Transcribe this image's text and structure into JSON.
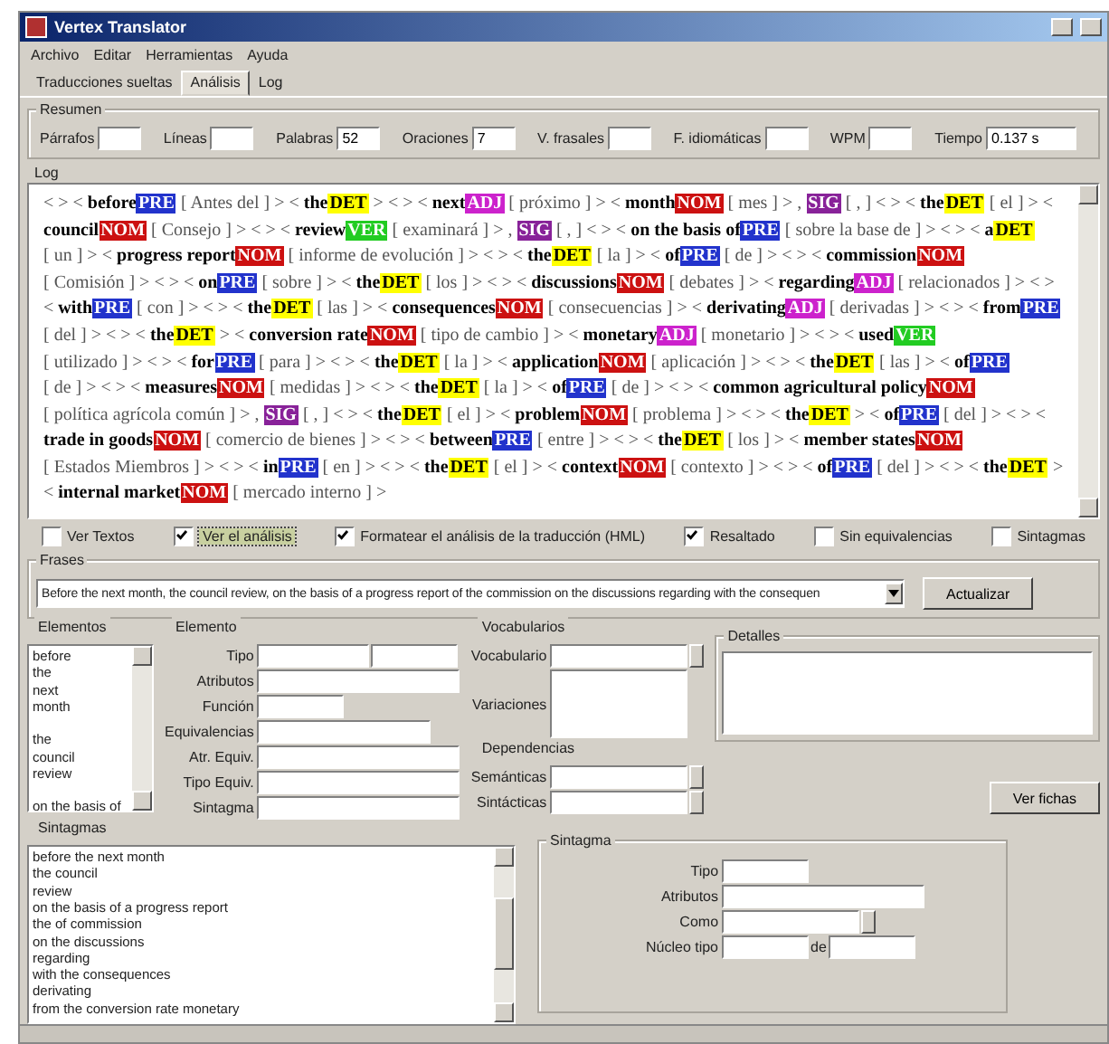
{
  "window": {
    "title": "Vertex Translator"
  },
  "menu": [
    "Archivo",
    "Editar",
    "Herramientas",
    "Ayuda"
  ],
  "tabs": [
    {
      "label": "Traducciones sueltas",
      "selected": false
    },
    {
      "label": "Análisis",
      "selected": true
    },
    {
      "label": "Log",
      "selected": false
    }
  ],
  "summary": {
    "title": "Resumen",
    "fields": [
      {
        "label": "Párrafos"
      },
      {
        "label": "Líneas"
      },
      {
        "label": "Palabras",
        "value": "52"
      },
      {
        "label": "Oraciones",
        "value": "7"
      },
      {
        "label": "V. frasales"
      },
      {
        "label": "F. idiomáticas"
      },
      {
        "label": "WPM"
      },
      {
        "label": "Tiempo",
        "value": "0.137 s"
      }
    ]
  },
  "log": {
    "title": "Log",
    "tokens": [
      {
        "pre": "< > <",
        "word": "before",
        "tag": "PRE",
        "color": "#2233cc",
        "post": "[ Antes del ] >"
      },
      {
        "pre": "<",
        "word": "the",
        "tag": "DET",
        "color": "#ffff00",
        "post": ">"
      },
      {
        "pre": "< > <",
        "word": "next",
        "tag": "ADJ",
        "color": "#cc22cc",
        "post": "[ próximo ] >"
      },
      {
        "pre": "<",
        "word": "month",
        "tag": "NOM",
        "color": "#cc1111",
        "post": "[ mes ] >"
      },
      {
        "pre": ",",
        "tag": "SIG",
        "color": "#882299",
        "post": "[ , ] < >"
      },
      {
        "pre": "<",
        "word": "the",
        "tag": "DET",
        "color": "#ffff00",
        "post": "[ el ] >"
      },
      {
        "pre": "<",
        "word": "council",
        "tag": "NOM",
        "color": "#cc1111",
        "post": "[ Consejo ] > < >"
      },
      {
        "pre": "<",
        "word": "review",
        "tag": "VER",
        "color": "#22cc22",
        "post": "[ examinará ] >"
      },
      {
        "pre": ",",
        "tag": "SIG",
        "color": "#882299",
        "post": "[ , ] < >"
      },
      {
        "pre": "<",
        "word": "on the basis of",
        "tag": "PRE",
        "color": "#2233cc",
        "post": "[ sobre la base de ] > < >"
      },
      {
        "pre": "<",
        "word": "a",
        "tag": "DET",
        "color": "#ffff00",
        "post": "[ un ] >"
      },
      {
        "pre": "<",
        "word": "progress report",
        "tag": "NOM",
        "color": "#cc1111",
        "post": "[ informe de evolución ] > < >"
      },
      {
        "pre": "<",
        "word": "the",
        "tag": "DET",
        "color": "#ffff00",
        "post": "[ la ] >"
      },
      {
        "pre": "<",
        "word": "of",
        "tag": "PRE",
        "color": "#2233cc",
        "post": "[ de ] > < >"
      },
      {
        "pre": "<",
        "word": "commission",
        "tag": "NOM",
        "color": "#cc1111",
        "post": "[ Comisión ] > < >"
      },
      {
        "pre": "<",
        "word": "on",
        "tag": "PRE",
        "color": "#2233cc",
        "post": "[ sobre ] >"
      },
      {
        "pre": "<",
        "word": "the",
        "tag": "DET",
        "color": "#ffff00",
        "post": "[ los ] > < >"
      },
      {
        "pre": "<",
        "word": "discussions",
        "tag": "NOM",
        "color": "#cc1111",
        "post": "[ debates ] >"
      },
      {
        "pre": "<",
        "word": "regarding",
        "tag": "ADJ",
        "color": "#cc22cc",
        "post": "[ relacionados ] > < >"
      },
      {
        "pre": "<",
        "word": "with",
        "tag": "PRE",
        "color": "#2233cc",
        "post": "[ con ] > < >"
      },
      {
        "pre": "<",
        "word": "the",
        "tag": "DET",
        "color": "#ffff00",
        "post": "[ las ] >"
      },
      {
        "pre": "<",
        "word": "consequences",
        "tag": "NOM",
        "color": "#cc1111",
        "post": "[ consecuencias ] >"
      },
      {
        "pre": "<",
        "word": "derivating",
        "tag": "ADJ",
        "color": "#cc22cc",
        "post": "[ derivadas ] > < >"
      },
      {
        "pre": "<",
        "word": "from",
        "tag": "PRE",
        "color": "#2233cc",
        "post": "[ del ] > < >"
      },
      {
        "pre": "<",
        "word": "the",
        "tag": "DET",
        "color": "#ffff00",
        "post": ">"
      },
      {
        "pre": "<",
        "word": "conversion rate",
        "tag": "NOM",
        "color": "#cc1111",
        "post": "[ tipo de cambio ] >"
      },
      {
        "pre": "<",
        "word": "monetary",
        "tag": "ADJ",
        "color": "#cc22cc",
        "post": "[ monetario ] > < >"
      },
      {
        "pre": "<",
        "word": "used",
        "tag": "VER",
        "color": "#22cc22",
        "post": "[ utilizado ] > < >"
      },
      {
        "pre": "<",
        "word": "for",
        "tag": "PRE",
        "color": "#2233cc",
        "post": "[ para ] > < >"
      },
      {
        "pre": "<",
        "word": "the",
        "tag": "DET",
        "color": "#ffff00",
        "post": "[ la ] >"
      },
      {
        "pre": "<",
        "word": "application",
        "tag": "NOM",
        "color": "#cc1111",
        "post": "[ aplicación ] > < >"
      },
      {
        "pre": "<",
        "word": "the",
        "tag": "DET",
        "color": "#ffff00",
        "post": "[ las ] >"
      },
      {
        "pre": "<",
        "word": "of",
        "tag": "PRE",
        "color": "#2233cc",
        "post": "[ de ] > < >"
      },
      {
        "pre": "<",
        "word": "measures",
        "tag": "NOM",
        "color": "#cc1111",
        "post": "[ medidas ] > < >"
      },
      {
        "pre": "<",
        "word": "the",
        "tag": "DET",
        "color": "#ffff00",
        "post": "[ la ] >"
      },
      {
        "pre": "<",
        "word": "of",
        "tag": "PRE",
        "color": "#2233cc",
        "post": "[ de ] > < >"
      },
      {
        "pre": "<",
        "word": "common agricultural policy",
        "tag": "NOM",
        "color": "#cc1111",
        "post": "[ política agrícola común ] >"
      },
      {
        "pre": ",",
        "tag": "SIG",
        "color": "#882299",
        "post": "[ , ] < >"
      },
      {
        "pre": "<",
        "word": "the",
        "tag": "DET",
        "color": "#ffff00",
        "post": "[ el ] >"
      },
      {
        "pre": "<",
        "word": "problem",
        "tag": "NOM",
        "color": "#cc1111",
        "post": "[ problema ] > < >"
      },
      {
        "pre": "<",
        "word": "the",
        "tag": "DET",
        "color": "#ffff00",
        "post": ">"
      },
      {
        "pre": "<",
        "word": "of",
        "tag": "PRE",
        "color": "#2233cc",
        "post": "[ del ] > < >"
      },
      {
        "pre": "<",
        "word": "trade in goods",
        "tag": "NOM",
        "color": "#cc1111",
        "post": "[ comercio de bienes ] > < >"
      },
      {
        "pre": "<",
        "word": "between",
        "tag": "PRE",
        "color": "#2233cc",
        "post": "[ entre ] > < >"
      },
      {
        "pre": "<",
        "word": "the",
        "tag": "DET",
        "color": "#ffff00",
        "post": "[ los ] >"
      },
      {
        "pre": "<",
        "word": "member states",
        "tag": "NOM",
        "color": "#cc1111",
        "post": "[ Estados Miembros ] > < >"
      },
      {
        "pre": "<",
        "word": "in",
        "tag": "PRE",
        "color": "#2233cc",
        "post": "[ en ] > < >"
      },
      {
        "pre": "<",
        "word": "the",
        "tag": "DET",
        "color": "#ffff00",
        "post": "[ el ] >"
      },
      {
        "pre": "<",
        "word": "context",
        "tag": "NOM",
        "color": "#cc1111",
        "post": "[ contexto ] > < >"
      },
      {
        "pre": "<",
        "word": "of",
        "tag": "PRE",
        "color": "#2233cc",
        "post": "[ del ] > < >"
      },
      {
        "pre": "<",
        "word": "the",
        "tag": "DET",
        "color": "#ffff00",
        "post": ">"
      },
      {
        "pre": "<",
        "word": "internal market",
        "tag": "NOM",
        "color": "#cc1111",
        "post": "[ mercado interno ] >"
      }
    ]
  },
  "options": [
    {
      "label": "Ver Textos",
      "checked": false,
      "focused": false
    },
    {
      "label": "Ver el análisis",
      "checked": true,
      "focused": true
    },
    {
      "label": "Formatear el análisis de la traducción (HML)",
      "checked": true,
      "focused": false
    },
    {
      "label": "Resaltado",
      "checked": true,
      "focused": false
    },
    {
      "label": "Sin equivalencias",
      "checked": false,
      "focused": false
    },
    {
      "label": "Sintagmas",
      "checked": false,
      "focused": false
    }
  ],
  "phrases": {
    "title": "Frases",
    "value": "Before the next month, the council review, on the basis of a progress report of the commission on the discussions regarding with the consequen",
    "button": "Actualizar"
  },
  "elements": {
    "title": "Elementos",
    "items": [
      {
        "text": "before",
        "separated": false
      },
      {
        "text": "the",
        "separated": false
      },
      {
        "text": "next",
        "separated": false
      },
      {
        "text": "month",
        "separated": false
      },
      {
        "text": "the",
        "separated": true
      },
      {
        "text": "council",
        "separated": false
      },
      {
        "text": "review",
        "separated": false
      },
      {
        "text": "on the basis of",
        "separated": true
      }
    ]
  },
  "element": {
    "title": "Elemento",
    "fields": [
      {
        "label": "Tipo",
        "kind": "double"
      },
      {
        "label": "Atributos",
        "kind": "wide"
      },
      {
        "label": "Función",
        "kind": "short"
      },
      {
        "label": "Equivalencias",
        "kind": "medium"
      },
      {
        "label": "Atr. Equiv.",
        "kind": "wide"
      },
      {
        "label": "Tipo Equiv.",
        "kind": "wide"
      },
      {
        "label": "Sintagma",
        "kind": "wide"
      }
    ]
  },
  "vocabularies": {
    "title": "Vocabularios",
    "fields": [
      {
        "label": "Vocabulario",
        "kind": "spin"
      },
      {
        "label": "Variaciones",
        "kind": "area"
      }
    ]
  },
  "details": {
    "title": "Detalles"
  },
  "dependencies": {
    "title": "Dependencias",
    "fields": [
      {
        "label": "Semánticas",
        "kind": "spin"
      },
      {
        "label": "Sintácticas",
        "kind": "spin"
      }
    ]
  },
  "cards_button": "Ver fichas",
  "phrase_list": {
    "title": "Sintagmas",
    "items": [
      "before the next month",
      "the council",
      "review",
      "on the basis of a progress report",
      "the of commission",
      "on the discussions",
      "regarding",
      "with the consequences",
      "derivating",
      "from the conversion rate monetary"
    ]
  },
  "phrase": {
    "title": "Sintagma",
    "fields": [
      {
        "label": "Tipo",
        "kind": "short"
      },
      {
        "label": "Atributos",
        "kind": "wide"
      },
      {
        "label": "Como",
        "kind": "spin"
      },
      {
        "label": "Núcleo tipo",
        "kind": "pair",
        "between": "de"
      }
    ]
  }
}
